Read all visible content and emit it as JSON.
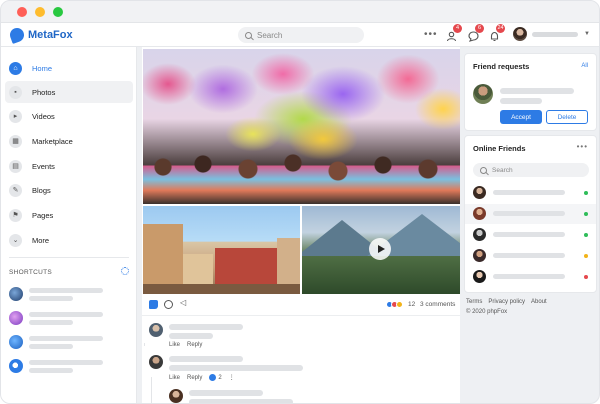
{
  "app": {
    "name": "MetaFox"
  },
  "header": {
    "search_placeholder": "Search",
    "badges": {
      "friends": "4",
      "messages": "6",
      "notifications": "24"
    }
  },
  "sidebar": {
    "items": [
      {
        "label": "Home",
        "icon": "home-icon"
      },
      {
        "label": "Photos",
        "icon": "photo-icon"
      },
      {
        "label": "Videos",
        "icon": "video-icon"
      },
      {
        "label": "Marketplace",
        "icon": "store-icon"
      },
      {
        "label": "Events",
        "icon": "calendar-icon"
      },
      {
        "label": "Blogs",
        "icon": "pencil-icon"
      },
      {
        "label": "Pages",
        "icon": "flag-icon"
      },
      {
        "label": "More",
        "icon": "chevron-down-icon"
      }
    ],
    "shortcuts_title": "SHORTCUTS"
  },
  "post": {
    "reaction_count": "12",
    "comments_label": "3 comments",
    "comments": [
      {
        "like": "Like",
        "reply": "Reply"
      },
      {
        "like": "Like",
        "reply": "Reply",
        "like_count": "2"
      }
    ]
  },
  "friend_requests": {
    "title": "Friend requests",
    "all_link": "All",
    "accept_label": "Accept",
    "delete_label": "Delete"
  },
  "online_friends": {
    "title": "Online Friends",
    "search_placeholder": "Search",
    "status_colors": [
      "#2ebd59",
      "#2ebd59",
      "#2ebd59",
      "#f2b318",
      "#e5484d"
    ]
  },
  "footer": {
    "terms": "Terms",
    "privacy": "Privacy policy",
    "about": "About",
    "copyright": "© 2020 phpFox"
  },
  "colors": {
    "accent": "#2d7be5",
    "badge": "#e5484d"
  }
}
